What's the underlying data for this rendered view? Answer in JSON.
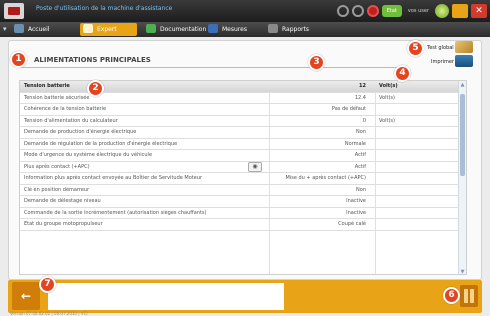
{
  "window": {
    "title": "Poste d'utilisation de la machine d'assistance",
    "status_label": "Etat",
    "user_label": "vos user"
  },
  "nav": {
    "tabs": [
      {
        "label": "Accueil"
      },
      {
        "label": "Expert"
      },
      {
        "label": "Documentation"
      },
      {
        "label": "Mesures"
      },
      {
        "label": "Rapports"
      }
    ]
  },
  "section": {
    "title": "ALIMENTATIONS PRINCIPALES",
    "test_global_label": "Test global",
    "imprimer_label": "Imprimer"
  },
  "badges": {
    "b1": "1",
    "b2": "2",
    "b3": "3",
    "b4": "4",
    "b5": "5",
    "b6": "6",
    "b7": "7"
  },
  "table": {
    "header": {
      "name": "Tension batterie",
      "value": "12",
      "unit": "Volt(s)"
    },
    "rows": [
      {
        "name": "Tension batterie sécurisée",
        "value": "12.4",
        "unit": "Volt(s)"
      },
      {
        "name": "Cohérence de la tension batterie",
        "value": "Pas de défaut",
        "unit": ""
      },
      {
        "name": "Tension d'alimentation du calculateur",
        "value": "0",
        "unit": "Volt(s)"
      },
      {
        "name": "Demande de production d'énergie électrique",
        "value": "Non",
        "unit": ""
      },
      {
        "name": "Demande de régulation de la production d'énergie électrique",
        "value": "Normale",
        "unit": ""
      },
      {
        "name": "Mode d'urgence du système électrique du véhicule",
        "value": "Actif",
        "unit": ""
      },
      {
        "name": "Plus après contact (+APC)",
        "value": "Actif",
        "unit": ""
      },
      {
        "name": "Information plus après contact envoyée au Boîtier de Servitude Moteur",
        "value": "Mise du + après contact (+APC)",
        "unit": ""
      },
      {
        "name": "Clé en position démarreur",
        "value": "Non",
        "unit": ""
      },
      {
        "name": "Demande de délestage niveau",
        "value": "Inactive",
        "unit": ""
      },
      {
        "name": "Commande de la sortie incrémentement (autorisation sièges chauffants)",
        "value": "Inactive",
        "unit": ""
      },
      {
        "name": "Etat du groupe motopropulseur",
        "value": "Coupé calé",
        "unit": ""
      }
    ]
  },
  "footer": {
    "status_text": "Version 07.00.02.02 | 06.07.2010 | VCI"
  },
  "colors": {
    "accent": "#e8a317",
    "badge": "#e2451f",
    "titlebar": "#1d1d1d"
  },
  "icons": {
    "back": "arrow-left-icon",
    "pause": "pause-icon",
    "camera": "camera-icon",
    "test_global": "wrench-icon",
    "imprimer": "printer-icon"
  }
}
